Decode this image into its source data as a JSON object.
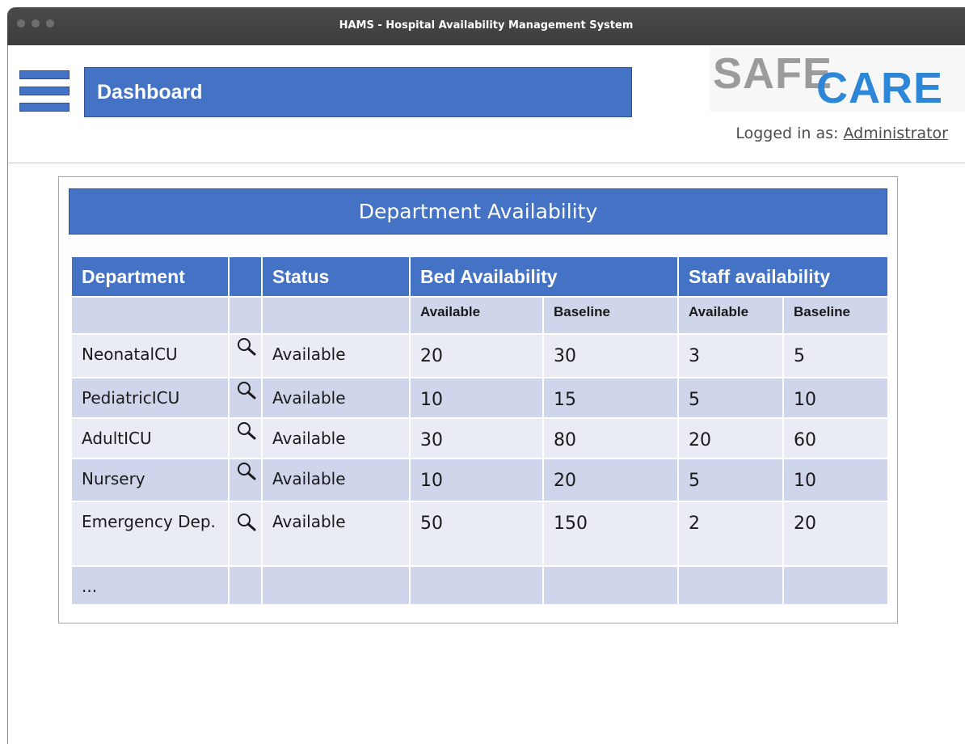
{
  "window": {
    "title": "HAMS - Hospital Availability Management System"
  },
  "header": {
    "title": "Dashboard"
  },
  "logo": {
    "text_left": "SAFE",
    "text_right": "CARE"
  },
  "login": {
    "prefix": "Logged in as:",
    "user": "Administrator"
  },
  "panel": {
    "title": "Department  Availability"
  },
  "table": {
    "headers": {
      "department": "Department",
      "status": "Status",
      "bed": "Bed Availability",
      "staff": "Staff availability"
    },
    "subheaders": {
      "bed_available": "Available",
      "bed_baseline": "Baseline",
      "staff_available": "Available",
      "staff_baseline": "Baseline"
    },
    "rows": [
      {
        "department": "NeonatalCU",
        "status": "Available",
        "bed_available": "20",
        "bed_baseline": "30",
        "staff_available": "3",
        "staff_baseline": "5"
      },
      {
        "department": "PediatricICU",
        "status": "Available",
        "bed_available": "10",
        "bed_baseline": "15",
        "staff_available": "5",
        "staff_baseline": "10"
      },
      {
        "department": "AdultICU",
        "status": "Available",
        "bed_available": "30",
        "bed_baseline": "80",
        "staff_available": "20",
        "staff_baseline": "60"
      },
      {
        "department": "Nursery",
        "status": "Available",
        "bed_available": "10",
        "bed_baseline": "20",
        "staff_available": "5",
        "staff_baseline": "10"
      },
      {
        "department": "Emergency Dep.",
        "status": "Available",
        "bed_available": "50",
        "bed_baseline": "150",
        "staff_available": "2",
        "staff_baseline": "20"
      }
    ],
    "more": "..."
  },
  "icons": {
    "menu": "hamburger-menu-icon",
    "row_action": "magnifier-icon"
  },
  "colors": {
    "accent": "#4472c4",
    "row_light": "#e9ebf5",
    "row_dark": "#cfd5ea",
    "logo_blue": "#2e86d6",
    "logo_gray": "#9b9b9b"
  }
}
